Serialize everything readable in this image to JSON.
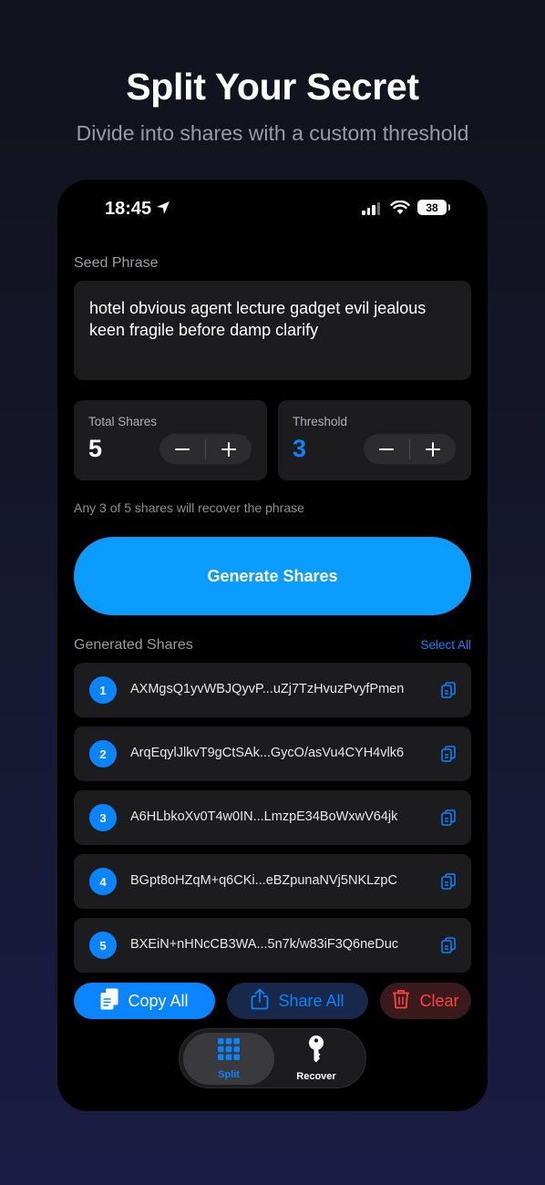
{
  "headline": "Split Your Secret",
  "subheadline": "Divide into shares with a custom threshold",
  "status_bar": {
    "time": "18:45",
    "battery": "38"
  },
  "seed": {
    "label": "Seed Phrase",
    "text": "hotel obvious agent lecture gadget evil jealous keen fragile before damp clarify"
  },
  "total_shares": {
    "label": "Total Shares",
    "value": "5",
    "minus": "−",
    "plus": "+"
  },
  "threshold": {
    "label": "Threshold",
    "value": "3",
    "minus": "−",
    "plus": "+"
  },
  "hint": "Any 3 of 5 shares will recover the phrase",
  "generate_label": "Generate Shares",
  "generated": {
    "title": "Generated Shares",
    "select_all": "Select All",
    "shares": [
      {
        "num": "1",
        "text": "AXMgsQ1yvWBJQyvP...uZj7TzHvuzPvyfPmen"
      },
      {
        "num": "2",
        "text": "ArqEqylJlkvT9gCtSAk...GycO/asVu4CYH4vlk6"
      },
      {
        "num": "3",
        "text": "A6HLbkoXv0T4w0IN...LmzpE34BoWxwV64jk"
      },
      {
        "num": "4",
        "text": "BGpt8oHZqM+q6CKi...eBZpunaNVj5NKLzpC"
      },
      {
        "num": "5",
        "text": "BXEiN+nHNcCB3WA...5n7k/w83iF3Q6neDuc"
      }
    ]
  },
  "actions": {
    "copy_all": "Copy All",
    "share_all": "Share All",
    "clear": "Clear"
  },
  "tabs": {
    "split": "Split",
    "recover": "Recover"
  },
  "colors": {
    "accent": "#0a84ff",
    "generate": "#0a9cff",
    "danger": "#ff453a"
  },
  "icons": [
    "location-arrow-icon",
    "signal-icon",
    "wifi-icon",
    "copy-icon",
    "document-icon",
    "share-icon",
    "trash-icon",
    "grid-icon",
    "key-icon"
  ]
}
